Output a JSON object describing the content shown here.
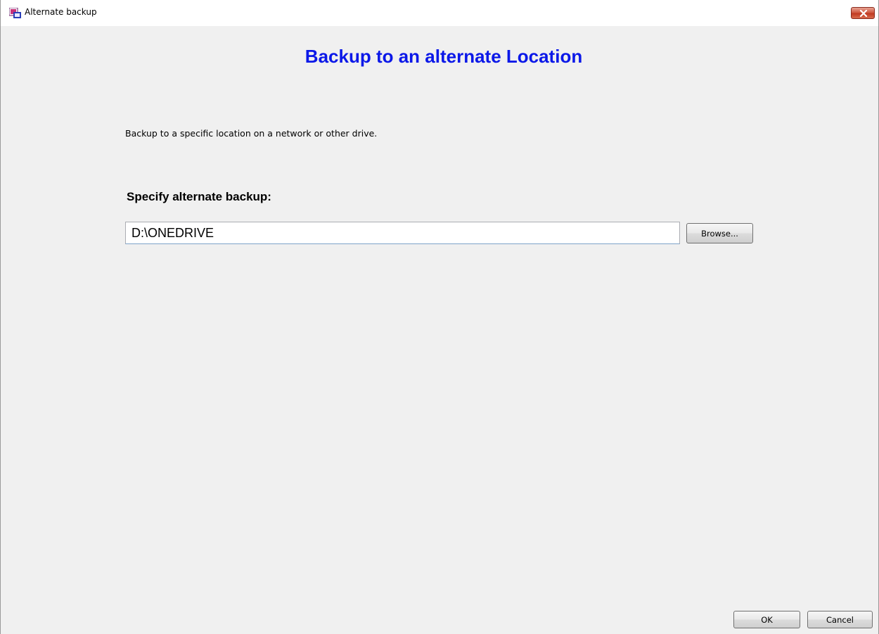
{
  "window": {
    "title": "Alternate backup",
    "app_icon": "app-backup-icon",
    "close_icon": "close-icon"
  },
  "main": {
    "heading": "Backup to an alternate Location",
    "description": "Backup to a specific location on a network or other drive.",
    "section_label": "Specify alternate backup:",
    "path_value": "D:\\ONEDRIVE",
    "browse_label": "Browse..."
  },
  "footer": {
    "ok_label": "OK",
    "cancel_label": "Cancel"
  },
  "colors": {
    "heading": "#0b18e8",
    "background": "#f0f0f0",
    "close_button": "#c9452c"
  }
}
